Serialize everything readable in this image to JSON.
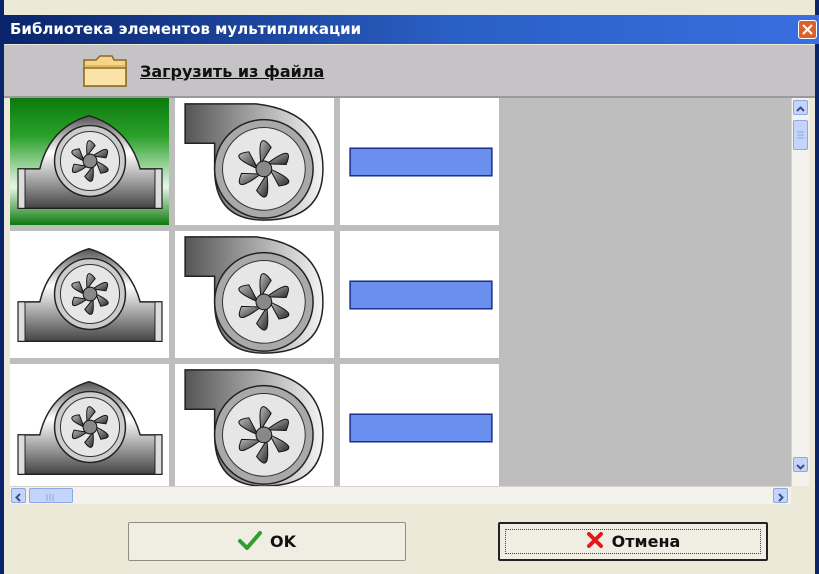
{
  "window": {
    "title": "Библиотека элементов мультипликации",
    "close_icon": "close-icon"
  },
  "toolbar": {
    "load_label": "Загрузить из файла",
    "load_icon": "folder-icon"
  },
  "library": {
    "rows": [
      [
        "fan-pipe",
        "fan-blower",
        "bar"
      ],
      [
        "fan-pipe",
        "fan-blower",
        "bar"
      ],
      [
        "fan-pipe",
        "fan-blower",
        "bar"
      ]
    ],
    "selected": "row1-col1",
    "colors": {
      "bar": "#6b8fee",
      "selected": "#2aa12a"
    }
  },
  "scrollbars": {
    "vertical": true,
    "horizontal": true
  },
  "footer": {
    "ok_label": "OK",
    "ok_icon": "checkmark-icon",
    "cancel_label": "Отмена",
    "cancel_icon": "x-icon"
  }
}
